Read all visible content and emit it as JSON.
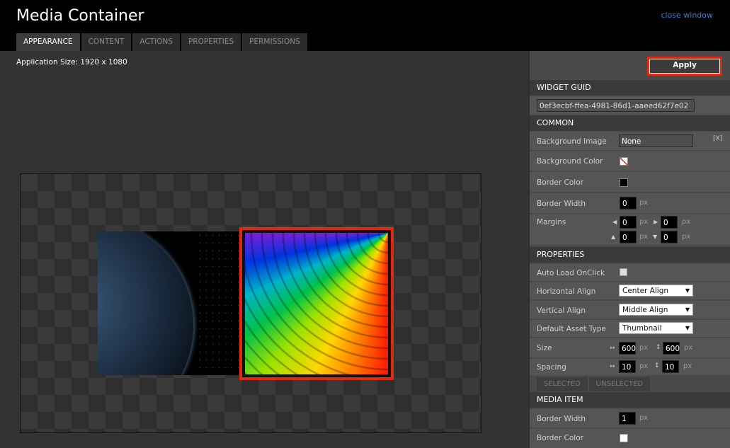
{
  "window": {
    "title": "Media Container",
    "close_label": "close window"
  },
  "tabs": [
    {
      "label": "APPEARANCE",
      "active": true
    },
    {
      "label": "CONTENT",
      "active": false
    },
    {
      "label": "ACTIONS",
      "active": false
    },
    {
      "label": "PROPERTIES",
      "active": false
    },
    {
      "label": "PERMISSIONS",
      "active": false
    }
  ],
  "main": {
    "app_size": "Application Size: 1920 x 1080"
  },
  "panel": {
    "apply_label": "Apply",
    "widget_guid": {
      "header": "WIDGET GUID",
      "value": "0ef3ecbf-ffea-4981-86d1-aaeed62f7e02"
    },
    "common": {
      "header": "COMMON",
      "background_image": {
        "label": "Background Image",
        "value": "None",
        "clear": "[X]"
      },
      "background_color": {
        "label": "Background Color"
      },
      "border_color": {
        "label": "Border Color",
        "color": "#000000"
      },
      "border_width": {
        "label": "Border Width",
        "value": "0",
        "unit": "px"
      },
      "margins": {
        "label": "Margins",
        "left": "0",
        "right": "0",
        "top": "0",
        "bottom": "0",
        "unit": "px"
      }
    },
    "properties": {
      "header": "PROPERTIES",
      "auto_load": {
        "label": "Auto Load OnClick",
        "checked": false
      },
      "horizontal_align": {
        "label": "Horizontal Align",
        "value": "Center Align"
      },
      "vertical_align": {
        "label": "Vertical Align",
        "value": "Middle Align"
      },
      "default_asset_type": {
        "label": "Default Asset Type",
        "value": "Thumbnail"
      },
      "size": {
        "label": "Size",
        "width": "600",
        "height": "600",
        "unit": "px"
      },
      "spacing": {
        "label": "Spacing",
        "horizontal": "10",
        "vertical": "10",
        "unit": "px"
      }
    },
    "sub_tabs": [
      "SELECTED",
      "UNSELECTED"
    ],
    "media_item": {
      "header": "MEDIA ITEM",
      "border_width": {
        "label": "Border Width",
        "value": "1",
        "unit": "px"
      },
      "border_color": {
        "label": "Border Color",
        "color": "#ffffff"
      }
    }
  },
  "colors": {
    "accent_highlight": "#e02a10",
    "link": "#3a7fd0"
  },
  "icons": [
    "clear-icon",
    "dropdown-caret-icon",
    "arrow-left-icon",
    "arrow-right-icon",
    "arrow-up-icon",
    "arrow-down-icon",
    "width-icon",
    "height-icon"
  ]
}
